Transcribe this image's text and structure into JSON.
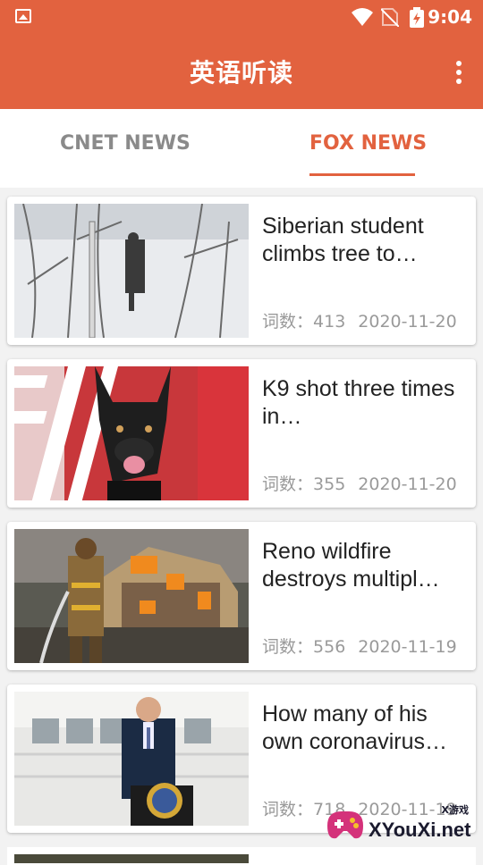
{
  "status_bar": {
    "time": "9:04"
  },
  "app_bar": {
    "title": "英语听读",
    "more_icon": "more-vert-icon"
  },
  "tabs": [
    {
      "label": "CNET NEWS",
      "active": false
    },
    {
      "label": "FOX NEWS",
      "active": true
    }
  ],
  "articles": [
    {
      "title": "Siberian student climbs tree to…",
      "word_count_label": "词数：",
      "word_count": "413",
      "date": "2020-11-20",
      "thumb": "man-in-snowy-birch-tree"
    },
    {
      "title": "K9 shot three times in…",
      "word_count_label": "词数：",
      "word_count": "355",
      "date": "2020-11-20",
      "thumb": "police-dog-with-flag"
    },
    {
      "title": "Reno wildfire destroys multipl…",
      "word_count_label": "词数：",
      "word_count": "556",
      "date": "2020-11-19",
      "thumb": "firefighter-burning-house"
    },
    {
      "title": "How many of his own coronavirus…",
      "word_count_label": "词数：",
      "word_count": "718",
      "date": "2020-11-19",
      "thumb": "politician-at-podium"
    }
  ],
  "watermark": {
    "text": "XYouXi.net",
    "small": "X游戏"
  },
  "colors": {
    "primary": "#e2623f",
    "tab_inactive": "#8a8a8a",
    "meta": "#9a9a9a"
  }
}
